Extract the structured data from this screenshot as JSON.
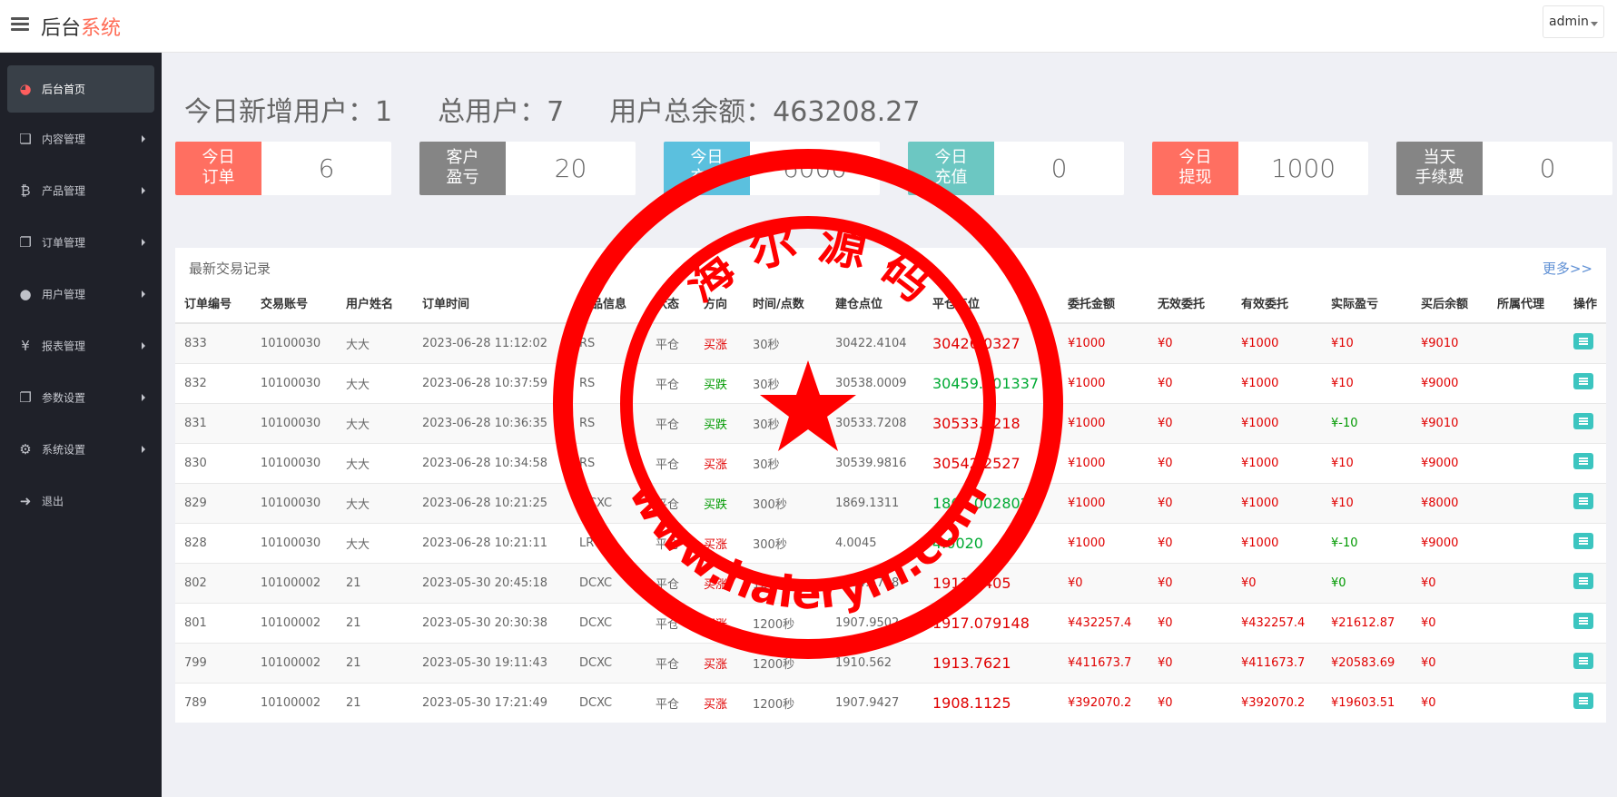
{
  "header": {
    "brand_main": "后台",
    "brand_accent": "系统",
    "user": "admin"
  },
  "sidebar": {
    "items": [
      {
        "label": "后台首页",
        "icon": "dashboard-icon",
        "glyph": "◕"
      },
      {
        "label": "内容管理",
        "icon": "book-icon",
        "glyph": "❏"
      },
      {
        "label": "产品管理",
        "icon": "bitcoin-icon",
        "glyph": "₿"
      },
      {
        "label": "订单管理",
        "icon": "copy-icon",
        "glyph": "❐"
      },
      {
        "label": "用户管理",
        "icon": "user-icon",
        "glyph": "●"
      },
      {
        "label": "报表管理",
        "icon": "yen-icon",
        "glyph": "¥"
      },
      {
        "label": "参数设置",
        "icon": "copy-icon",
        "glyph": "❐"
      },
      {
        "label": "系统设置",
        "icon": "gears-icon",
        "glyph": "⚙"
      },
      {
        "label": "退出",
        "icon": "sign-out-icon",
        "glyph": "➜"
      }
    ]
  },
  "summary": {
    "new_users": "今日新增用户：1",
    "total_users": "总用户：7",
    "total_balance": "用户总余额：463208.27"
  },
  "stats": [
    {
      "label": "今日订单",
      "value": "6",
      "color": "#ff6f61"
    },
    {
      "label": "客户盈亏",
      "value": "20",
      "color": "#858585"
    },
    {
      "label": "今日充值",
      "value": "6000",
      "color": "#5bc0de"
    },
    {
      "label": "今日充值",
      "value": "0",
      "color": "#6cc7c2"
    },
    {
      "label": "今日提现",
      "value": "1000",
      "color": "#ff6f61"
    },
    {
      "label": "当天手续费",
      "value": "0",
      "color": "#858585"
    }
  ],
  "panel": {
    "title": "最新交易记录",
    "more": "更多>>"
  },
  "table": {
    "columns": [
      "订单编号",
      "交易账号",
      "用户姓名",
      "订单时间",
      "产品信息",
      "状态",
      "方向",
      "时间/点数",
      "建仓点位",
      "平仓点位",
      "委托金额",
      "无效委托",
      "有效委托",
      "实际盈亏",
      "买后余额",
      "所属代理",
      "操作"
    ],
    "rows": [
      {
        "id": "833",
        "account": "10100030",
        "name": "大大",
        "time": "2023-06-28 11:12:02",
        "product": "RS",
        "status": "平仓",
        "direction": "买涨",
        "dir_up": true,
        "period": "30秒",
        "open": "30422.4104",
        "close": "30426.0327",
        "close_up": true,
        "amount": "¥1000",
        "invalid": "¥0",
        "valid": "¥1000",
        "pnl": "¥10",
        "pnl_pos": true,
        "balance": "¥9010",
        "agent": ""
      },
      {
        "id": "832",
        "account": "10100030",
        "name": "大大",
        "time": "2023-06-28 10:37:59",
        "product": "RS",
        "status": "平仓",
        "direction": "买跌",
        "dir_up": false,
        "period": "30秒",
        "open": "30538.0009",
        "close": "30459.001337",
        "close_up": false,
        "amount": "¥1000",
        "invalid": "¥0",
        "valid": "¥1000",
        "pnl": "¥10",
        "pnl_pos": true,
        "balance": "¥9000",
        "agent": ""
      },
      {
        "id": "831",
        "account": "10100030",
        "name": "大大",
        "time": "2023-06-28 10:36:35",
        "product": "RS",
        "status": "平仓",
        "direction": "买跌",
        "dir_up": false,
        "period": "30秒",
        "open": "30533.7208",
        "close": "30533.7218",
        "close_up": true,
        "amount": "¥1000",
        "invalid": "¥0",
        "valid": "¥1000",
        "pnl": "¥-10",
        "pnl_pos": false,
        "balance": "¥9010",
        "agent": ""
      },
      {
        "id": "830",
        "account": "10100030",
        "name": "大大",
        "time": "2023-06-28 10:34:58",
        "product": "RS",
        "status": "平仓",
        "direction": "买涨",
        "dir_up": true,
        "period": "30秒",
        "open": "30539.9816",
        "close": "30542.2527",
        "close_up": true,
        "amount": "¥1000",
        "invalid": "¥0",
        "valid": "¥1000",
        "pnl": "¥10",
        "pnl_pos": true,
        "balance": "¥9000",
        "agent": ""
      },
      {
        "id": "829",
        "account": "10100030",
        "name": "大大",
        "time": "2023-06-28 10:21:25",
        "product": "DCXC",
        "status": "平仓",
        "direction": "买跌",
        "dir_up": false,
        "period": "300秒",
        "open": "1869.1311",
        "close": "1869.002802",
        "close_up": false,
        "amount": "¥1000",
        "invalid": "¥0",
        "valid": "¥1000",
        "pnl": "¥10",
        "pnl_pos": true,
        "balance": "¥8000",
        "agent": ""
      },
      {
        "id": "828",
        "account": "10100030",
        "name": "大大",
        "time": "2023-06-28 10:21:11",
        "product": "LR",
        "status": "平仓",
        "direction": "买涨",
        "dir_up": true,
        "period": "300秒",
        "open": "4.0045",
        "close": "4.0020",
        "close_up": false,
        "amount": "¥1000",
        "invalid": "¥0",
        "valid": "¥1000",
        "pnl": "¥-10",
        "pnl_pos": false,
        "balance": "¥9000",
        "agent": ""
      },
      {
        "id": "802",
        "account": "10100002",
        "name": "21",
        "time": "2023-05-30 20:45:18",
        "product": "DCXC",
        "status": "平仓",
        "direction": "买涨",
        "dir_up": true,
        "period": "1200秒",
        "open": "1904.5718",
        "close": "1911.0405",
        "close_up": true,
        "amount": "¥0",
        "invalid": "¥0",
        "valid": "¥0",
        "pnl": "¥0",
        "pnl_pos": false,
        "balance": "¥0",
        "agent": ""
      },
      {
        "id": "801",
        "account": "10100002",
        "name": "21",
        "time": "2023-05-30 20:30:38",
        "product": "DCXC",
        "status": "平仓",
        "direction": "买涨",
        "dir_up": true,
        "period": "1200秒",
        "open": "1907.9502",
        "close": "1917.079148",
        "close_up": true,
        "amount": "¥432257.4",
        "invalid": "¥0",
        "valid": "¥432257.4",
        "pnl": "¥21612.87",
        "pnl_pos": true,
        "balance": "¥0",
        "agent": ""
      },
      {
        "id": "799",
        "account": "10100002",
        "name": "21",
        "time": "2023-05-30 19:11:43",
        "product": "DCXC",
        "status": "平仓",
        "direction": "买涨",
        "dir_up": true,
        "period": "1200秒",
        "open": "1910.562",
        "close": "1913.7621",
        "close_up": true,
        "amount": "¥411673.7",
        "invalid": "¥0",
        "valid": "¥411673.7",
        "pnl": "¥20583.69",
        "pnl_pos": true,
        "balance": "¥0",
        "agent": ""
      },
      {
        "id": "789",
        "account": "10100002",
        "name": "21",
        "time": "2023-05-30 17:21:49",
        "product": "DCXC",
        "status": "平仓",
        "direction": "买涨",
        "dir_up": true,
        "period": "1200秒",
        "open": "1907.9427",
        "close": "1908.1125",
        "close_up": true,
        "amount": "¥392070.2",
        "invalid": "¥0",
        "valid": "¥392070.2",
        "pnl": "¥19603.51",
        "pnl_pos": true,
        "balance": "¥0",
        "agent": ""
      }
    ]
  },
  "watermark": {
    "top_text": "海 尔 源 码",
    "bottom_text": "www.haierym.com",
    "color": "#ff0000"
  }
}
